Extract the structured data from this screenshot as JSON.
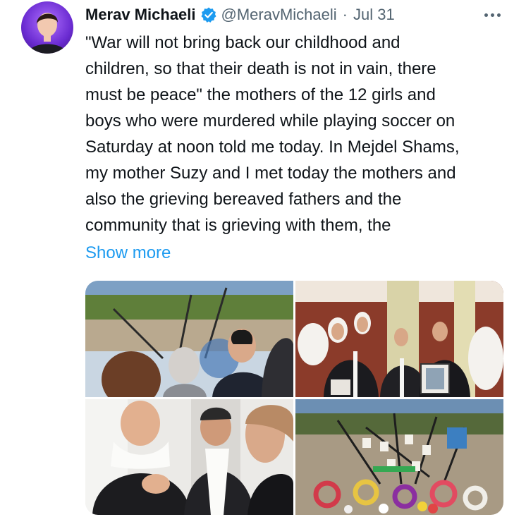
{
  "author": {
    "name": "Merav Michaeli",
    "handle": "@MeravMichaeli",
    "separator": "·",
    "date": "Jul 31",
    "verified_icon": "verified-badge-icon",
    "avatar_icon": "profile-photo"
  },
  "tweet": {
    "text": "\"War will not bring back our childhood and\nchildren, so that their death is not in vain, there\nmust be peace\" the mothers of the 12 girls and\nboys who were murdered while playing soccer on\nSaturday at noon told me today. In Mejdel Shams,\nmy mother Suzy and I met today the mothers and\nalso the grieving bereaved fathers and the\ncommunity that is grieving with them, the",
    "show_more": "Show more"
  },
  "media": {
    "count": 4,
    "photos": [
      "memorial-site-photo",
      "mothers-gathering-photo",
      "bereaved-fathers-photo",
      "memorial-flowers-photo"
    ]
  },
  "colors": {
    "text": "#0f1419",
    "secondary": "#536471",
    "link": "#1d9bf0",
    "verified": "#1d9bf0",
    "avatar_bg": "#6a2bd1"
  },
  "menu": {
    "icon": "more-options-icon"
  }
}
